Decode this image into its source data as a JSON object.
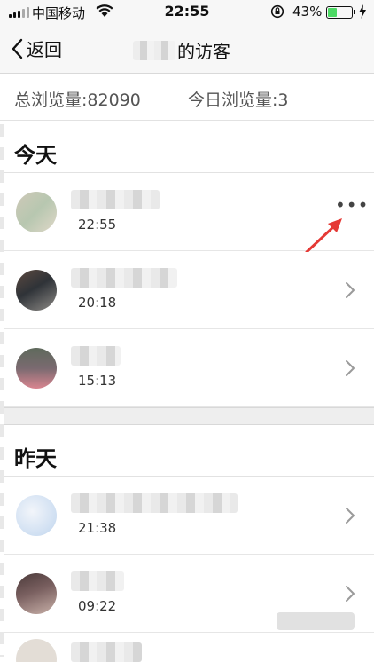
{
  "status_bar": {
    "carrier": "中国移动",
    "time": "22:55",
    "battery_percent": "43%",
    "battery_level": 0.43,
    "icons": [
      "signal-icon",
      "wifi-icon",
      "rotation-lock-icon",
      "battery-icon",
      "charging-icon"
    ]
  },
  "nav": {
    "back_label": "返回",
    "title": "的访客"
  },
  "stats": {
    "total": "总浏览量:82090",
    "today": "今日浏览量:3"
  },
  "sections": [
    {
      "header": "今天",
      "rows": [
        {
          "time": "22:55",
          "action": "more"
        },
        {
          "time": "20:18",
          "action": "chevron"
        },
        {
          "time": "15:13",
          "action": "chevron"
        }
      ]
    },
    {
      "header": "昨天",
      "rows": [
        {
          "time": "21:38",
          "action": "chevron"
        },
        {
          "time": "09:22",
          "action": "chevron"
        }
      ]
    }
  ],
  "more_label": "•••",
  "colors": {
    "annotation_arrow": "#e53935",
    "battery_fill": "#4cd964"
  }
}
